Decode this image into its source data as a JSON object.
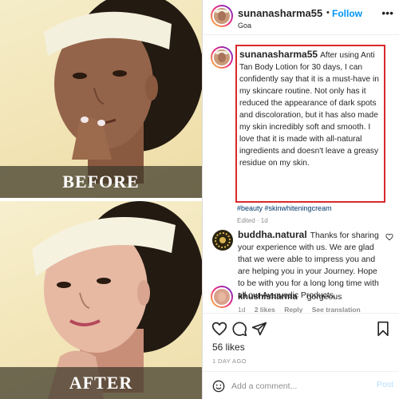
{
  "photos": {
    "before_label": "BEFORE",
    "after_label": "AFTER"
  },
  "post": {
    "username": "sunanasharma55",
    "follow_dot": "•",
    "follow_label": "Follow",
    "location": "Goa",
    "more_icon": "more-horizontal-icon"
  },
  "caption": {
    "username": "sunanasharma55",
    "text": "After using Anti Tan Body Lotion for 30 days, I can confidently say that it is a must-have in my skincare routine. Not only has it reduced the appearance of dark spots and discoloration, but it has also made my skin incredibly soft and smooth. I love that it is made with all-natural ingredients and doesn't leave a greasy residue on my skin.",
    "hashtags": "#beauty #skinwhiteningcream",
    "meta": "Edited · 1d",
    "highlight_color": "#d9292b"
  },
  "reply": {
    "username": "buddha.natural",
    "text": "Thanks for sharing your experience with us. We are glad that we were able to impress you and are helping you in your Journey. Hope to be with you for a long long time with all our Ayurvedic Products.",
    "time": "1d",
    "likes": "2 likes",
    "reply_label": "Reply",
    "translation_label": "See translation"
  },
  "comment2": {
    "username": "khushisharma",
    "text": "gorgeous"
  },
  "engagement": {
    "likes": "56 likes",
    "time_ago": "1 DAY AGO"
  },
  "add_comment": {
    "placeholder": "Add a comment...",
    "post_label": "Post"
  },
  "colors": {
    "link_blue": "#0095f6",
    "post_disabled": "#b2dffc",
    "meta_gray": "#8e8e8e"
  }
}
